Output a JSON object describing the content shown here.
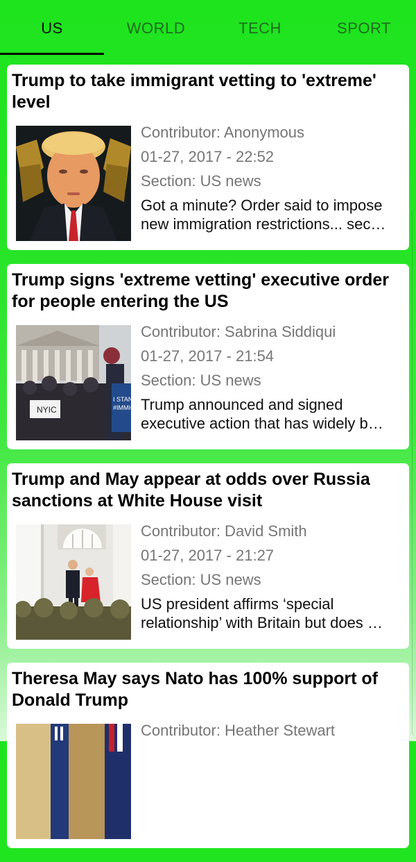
{
  "tabs": [
    {
      "label": "US",
      "active": true
    },
    {
      "label": "WORLD",
      "active": false
    },
    {
      "label": "TECH",
      "active": false
    },
    {
      "label": "SPORT",
      "active": false
    }
  ],
  "colors": {
    "background_top": "#1ee41e",
    "background_bottom": "#d9f9d9",
    "active_tab_text": "#0c0c0c",
    "inactive_tab_text": "#1c6e1c",
    "meta_text": "#767676"
  },
  "articles": [
    {
      "title": "Trump to take immigrant vetting to 'extreme' level",
      "contributor": "Contributor: Anonymous",
      "date": "01-27, 2017 - 22:52",
      "section": "Section: US news",
      "summary_line1": "Got a minute? Order said to impose",
      "summary_line2": "new immigration restrictions... sec…",
      "image": "portrait-photo"
    },
    {
      "title": "Trump signs 'extreme vetting' executive order for people entering the US",
      "contributor": "Contributor: Sabrina Siddiqui",
      "date": "01-27, 2017 - 21:54",
      "section": "Section: US news",
      "summary_line1": "Trump announced and signed",
      "summary_line2": "executive action that has widely b…",
      "image": "protest-photo"
    },
    {
      "title": "Trump and May appear at odds over Russia sanctions at White House visit",
      "contributor": "Contributor: David Smith",
      "date": "01-27, 2017 - 21:27",
      "section": "Section: US news",
      "summary_line1": "US president affirms ‘special",
      "summary_line2": "relationship’ with Britain but does …",
      "image": "white-house-photo"
    },
    {
      "title": "Theresa May says Nato has 100% support of Donald Trump",
      "contributor": "Contributor: Heather Stewart",
      "date": "",
      "section": "",
      "summary_line1": "",
      "summary_line2": "",
      "image": "flags-photo"
    }
  ]
}
